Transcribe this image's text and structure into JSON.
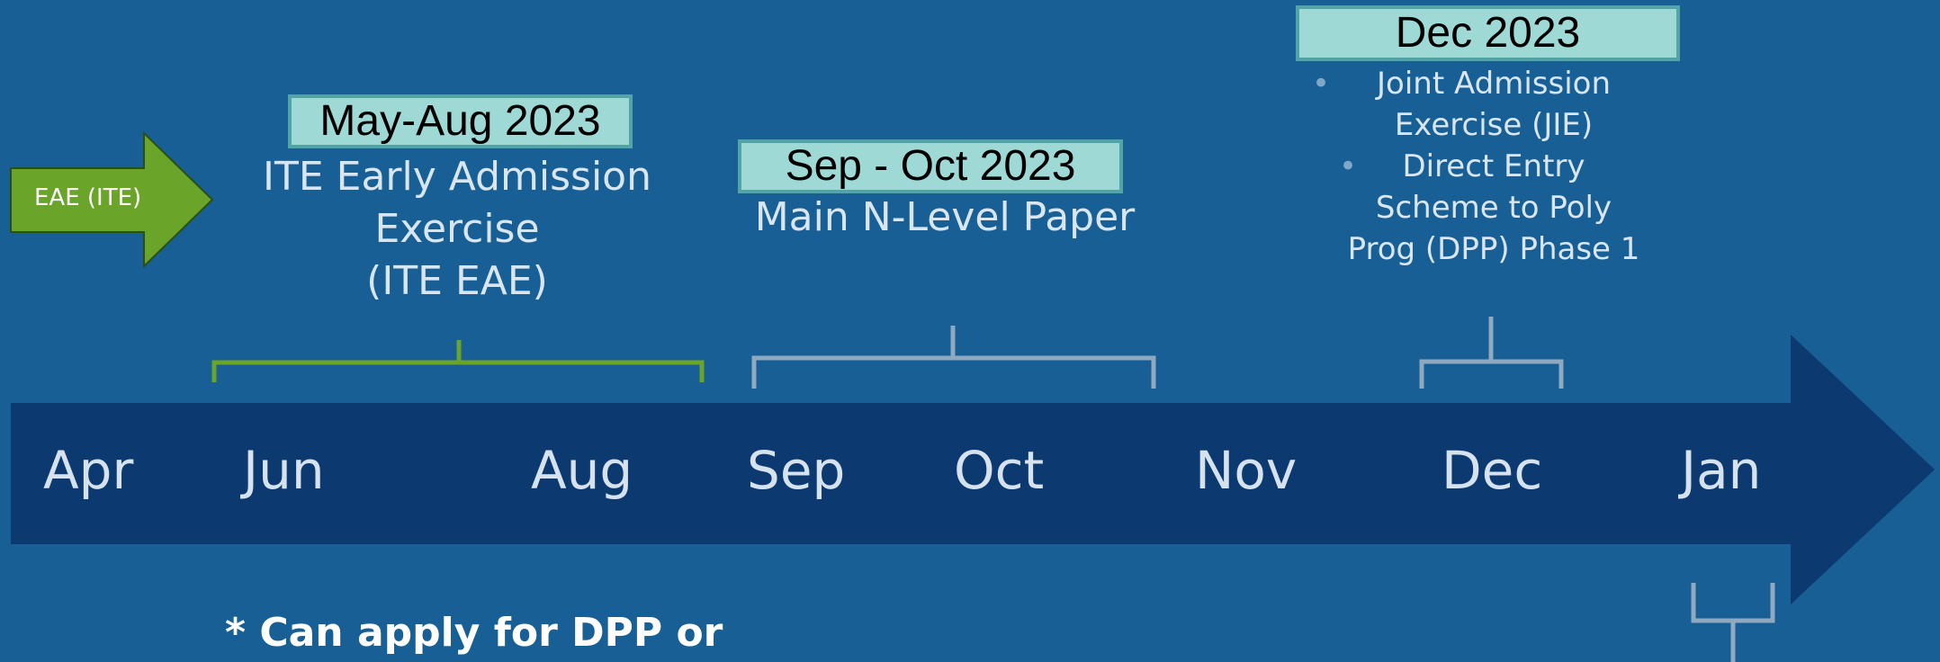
{
  "colors": {
    "background": "#175f94",
    "timeline_arrow": "#0c3a70",
    "date_box_fill": "#9ed9d6",
    "date_box_border": "#53a4a6",
    "green_accent": "#6aa52a",
    "grey_bracket": "#8ea9c0"
  },
  "eae_arrow": {
    "label": "EAE (ITE)",
    "icon": "green-right-arrow"
  },
  "timeline": {
    "months": [
      "Apr",
      "Jun",
      "Aug",
      "Sep",
      "Oct",
      "Nov",
      "Dec",
      "Jan"
    ]
  },
  "phases": [
    {
      "date": "May-Aug 2023",
      "lines": [
        "ITE Early Admission",
        "Exercise",
        "(ITE EAE)"
      ]
    },
    {
      "date": "Sep - Oct 2023",
      "lines": [
        "Main N-Level Paper"
      ]
    },
    {
      "date": "Dec 2023",
      "lines": [
        "Joint Admission",
        "Exercise (JIE)",
        "Direct Entry",
        "Scheme to Poly",
        "Prog (DPP) Phase 1"
      ],
      "bullet_glyph": "•"
    }
  ],
  "note": "* Can apply for DPP or"
}
